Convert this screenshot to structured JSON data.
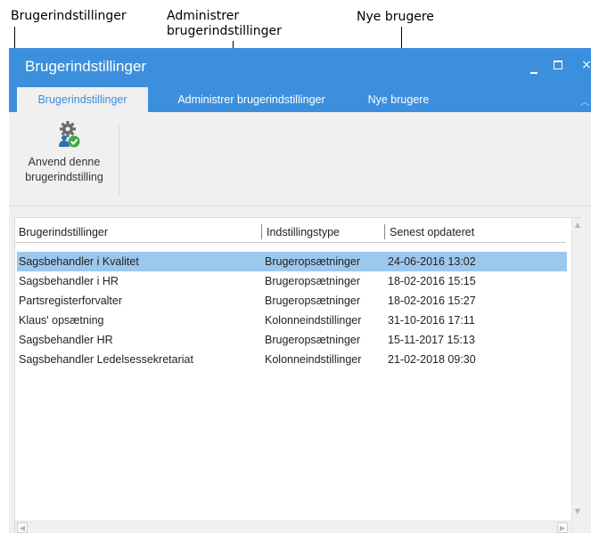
{
  "annotations": {
    "brugerindstillinger": "Brugerindstillinger",
    "administrer_line1": "Administrer",
    "administrer_line2": "brugerindstillinger",
    "nye_brugere": "Nye brugere"
  },
  "window": {
    "title": "Brugerindstillinger",
    "minimize_icon": "minimize-icon",
    "maximize_icon": "maximize-icon",
    "close_glyph": "×"
  },
  "tabs": [
    {
      "label": "Brugerindstillinger",
      "active": true
    },
    {
      "label": "Administrer brugerindstillinger",
      "active": false
    },
    {
      "label": "Nye brugere",
      "active": false
    }
  ],
  "ribbon": {
    "apply_button": {
      "label": "Anvend denne\nbrugerindstilling",
      "icon": "gear-check-icon"
    }
  },
  "grid": {
    "columns": [
      "Brugerindstillinger",
      "Indstillingstype",
      "Senest opdateret"
    ],
    "rows": [
      {
        "name": "Sagsbehandler i Kvalitet",
        "type": "Brugeropsætninger",
        "updated": "24-06-2016 13:02",
        "selected": true
      },
      {
        "name": "Sagsbehandler i HR",
        "type": "Brugeropsætninger",
        "updated": "18-02-2016 15:15",
        "selected": false
      },
      {
        "name": "Partsregisterforvalter",
        "type": "Brugeropsætninger",
        "updated": "18-02-2016 15:27",
        "selected": false
      },
      {
        "name": "Klaus' opsætning",
        "type": "Kolonneindstillinger",
        "updated": "31-10-2016 17:11",
        "selected": false
      },
      {
        "name": "Sagsbehandler HR",
        "type": "Brugeropsætninger",
        "updated": "15-11-2017 15:13",
        "selected": false
      },
      {
        "name": "Sagsbehandler Ledelsessekretariat",
        "type": "Kolonneindstillinger",
        "updated": "21-02-2018 09:30",
        "selected": false
      }
    ]
  },
  "colors": {
    "accent": "#3c8fdc",
    "selection": "#9dc8ee",
    "ribbon_bg": "#f0f0f0"
  }
}
